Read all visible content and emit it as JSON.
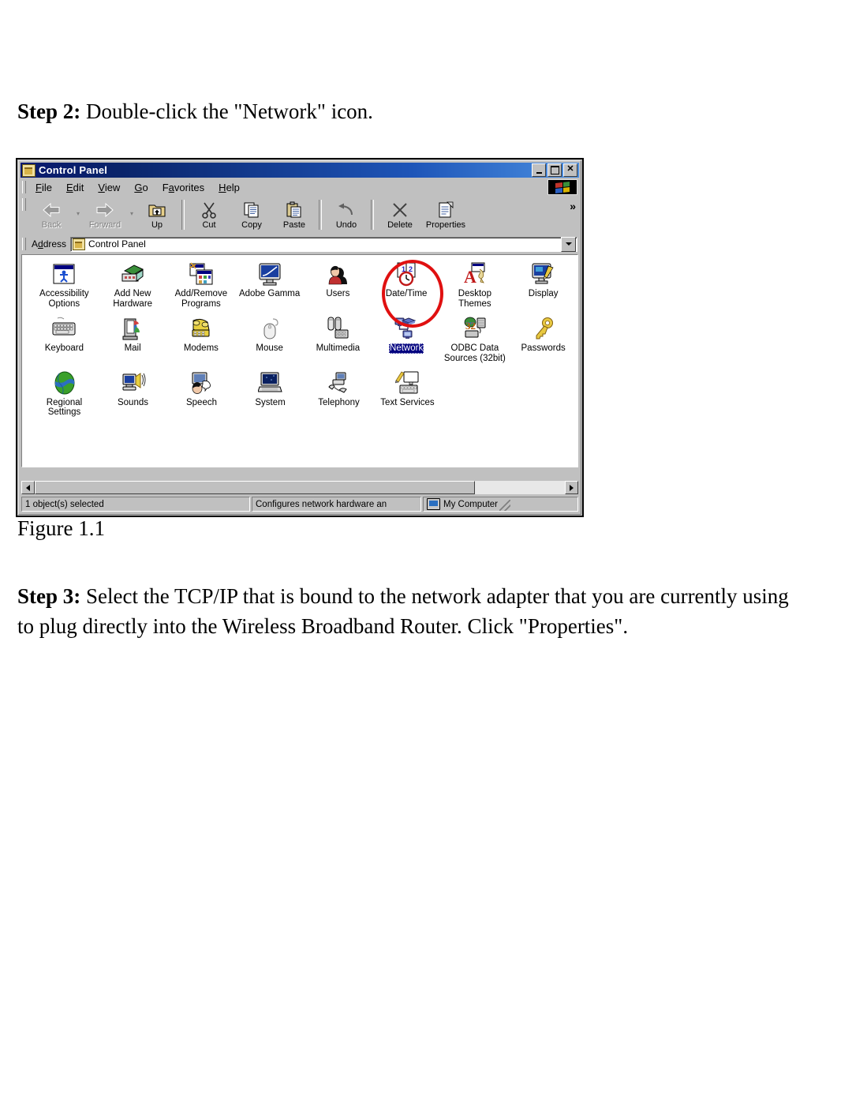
{
  "document": {
    "step2": {
      "label": "Step 2:",
      "text": " Double-click the \"Network\" icon."
    },
    "figure_caption": "Figure 1.1",
    "step3": {
      "label": "Step 3:",
      "text": " Select the TCP/IP that is bound to the network adapter that you are currently using to plug directly into the Wireless Broadband Router. Click \"Properties\"."
    }
  },
  "window": {
    "title": "Control Panel",
    "title_icon": "control-panel-folder-icon",
    "controls": {
      "minimize": "_",
      "maximize": "□",
      "close": "✕"
    },
    "menu": [
      {
        "accel": "F",
        "rest": "ile"
      },
      {
        "accel": "E",
        "rest": "dit"
      },
      {
        "accel": "V",
        "rest": "iew"
      },
      {
        "accel": "G",
        "rest": "o"
      },
      {
        "accel": "F",
        "rest": "avorites",
        "pre": "F"
      },
      {
        "accel": "H",
        "rest": "elp"
      }
    ],
    "menu_labels": [
      "File",
      "Edit",
      "View",
      "Go",
      "Favorites",
      "Help"
    ],
    "toolbar": {
      "items": [
        {
          "label": "Back",
          "icon": "back-arrow-icon",
          "disabled": true,
          "has_dropdown": true
        },
        {
          "label": "Forward",
          "icon": "forward-arrow-icon",
          "disabled": true,
          "has_dropdown": true
        },
        {
          "label": "Up",
          "icon": "up-folder-icon",
          "disabled": false
        },
        {
          "label": "Cut",
          "icon": "scissors-icon",
          "disabled": false
        },
        {
          "label": "Copy",
          "icon": "copy-pages-icon",
          "disabled": false
        },
        {
          "label": "Paste",
          "icon": "clipboard-icon",
          "disabled": false
        },
        {
          "label": "Undo",
          "icon": "undo-arrow-icon",
          "disabled": false
        },
        {
          "label": "Delete",
          "icon": "x-delete-icon",
          "disabled": false
        },
        {
          "label": "Properties",
          "icon": "properties-sheet-icon",
          "disabled": false
        }
      ],
      "overflow": "»"
    },
    "address": {
      "label": "Address",
      "value": "Control Panel",
      "icon": "control-panel-folder-icon"
    },
    "icons": [
      [
        {
          "label": "Accessibility Options",
          "glyph": "accessibility-icon"
        },
        {
          "label": "Add New Hardware",
          "glyph": "add-hardware-icon"
        },
        {
          "label": "Add/Remove Programs",
          "glyph": "add-remove-programs-icon"
        },
        {
          "label": "Adobe Gamma",
          "glyph": "adobe-gamma-icon"
        },
        {
          "label": "Users",
          "glyph": "users-icon"
        },
        {
          "label": "Date/Time",
          "glyph": "date-time-icon"
        },
        {
          "label": "Desktop Themes",
          "glyph": "desktop-themes-icon"
        },
        {
          "label": "Display",
          "glyph": "display-icon"
        }
      ],
      [
        {
          "label": "Keyboard",
          "glyph": "keyboard-icon"
        },
        {
          "label": "Mail",
          "glyph": "mail-icon"
        },
        {
          "label": "Modems",
          "glyph": "modem-icon"
        },
        {
          "label": "Mouse",
          "glyph": "mouse-icon"
        },
        {
          "label": "Multimedia",
          "glyph": "multimedia-icon"
        },
        {
          "label": "Network",
          "glyph": "network-icon",
          "selected": true,
          "annotated": true
        },
        {
          "label": "ODBC Data Sources (32bit)",
          "glyph": "odbc-icon"
        },
        {
          "label": "Passwords",
          "glyph": "passwords-key-icon"
        }
      ],
      [
        {
          "label": "Regional Settings",
          "glyph": "regional-globe-icon"
        },
        {
          "label": "Sounds",
          "glyph": "sounds-speaker-icon"
        },
        {
          "label": "Speech",
          "glyph": "speech-icon"
        },
        {
          "label": "System",
          "glyph": "system-computer-icon"
        },
        {
          "label": "Telephony",
          "glyph": "telephony-icon"
        },
        {
          "label": "Text Services",
          "glyph": "text-services-icon"
        }
      ]
    ],
    "statusbar": {
      "selection": "1 object(s) selected",
      "description": "Configures network hardware an",
      "zone": "My Computer",
      "zone_icon": "my-computer-icon"
    }
  },
  "colors": {
    "titlebar_start": "#0a1a6e",
    "titlebar_end": "#4a8ee0",
    "window_face": "#c0c0c0",
    "selection": "#000080",
    "annotation_ring": "#e01010"
  }
}
